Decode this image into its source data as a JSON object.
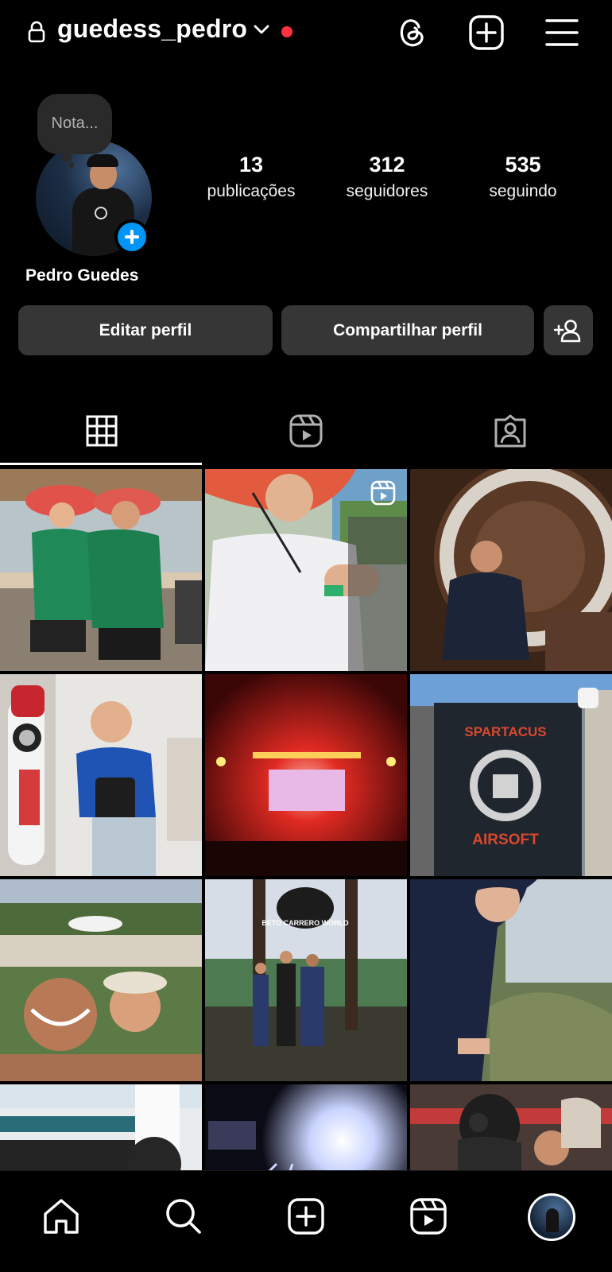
{
  "header": {
    "username": "guedess_pedro",
    "icons": [
      "lock-icon",
      "chevron-down-icon",
      "threads-icon",
      "create-post-icon",
      "menu-icon"
    ],
    "notification_color": "#ff3040"
  },
  "profile": {
    "note_placeholder": "Nota...",
    "full_name": "Pedro Guedes",
    "stats": {
      "posts_count": "13",
      "posts_label": "publicações",
      "followers_count": "312",
      "followers_label": "seguidores",
      "following_count": "535",
      "following_label": "seguindo"
    }
  },
  "actions": {
    "edit_label": "Editar perfil",
    "share_label": "Compartilhar perfil",
    "add_user_icon": "add-user-icon"
  },
  "tabs": [
    {
      "name": "posts-grid",
      "icon": "grid-icon",
      "active": true
    },
    {
      "name": "reels",
      "icon": "reels-icon",
      "active": false
    },
    {
      "name": "tagged",
      "icon": "tagged-icon",
      "active": false
    }
  ],
  "posts_grid": {
    "cells": [
      {
        "scene": "two people in green shirts and hats",
        "badge": ""
      },
      {
        "scene": "boy in white shirt with hat",
        "badge": "reel-icon"
      },
      {
        "scene": "boy seated in front of vault door",
        "badge": ""
      },
      {
        "scene": "child holding toy remote control",
        "badge": ""
      },
      {
        "scene": "concert stage with red lights",
        "badge": ""
      },
      {
        "scene": "Spartacus Airsoft banner",
        "badge": "carousel-icon"
      },
      {
        "scene": "family selfie at water park",
        "badge": ""
      },
      {
        "scene": "family at Beto Carrero World bridge",
        "badge": ""
      },
      {
        "scene": "boy in dark jacket outdoors",
        "badge": ""
      },
      {
        "scene": "arena building",
        "badge": ""
      },
      {
        "scene": "concert lights",
        "badge": ""
      },
      {
        "scene": "person in gas mask",
        "badge": ""
      }
    ],
    "text_in_photos": {
      "banner_top": "SPARTACUS",
      "banner_bottom": "AIRSOFT",
      "park_sign": "BETO CARRERO WORLD"
    }
  },
  "bottom_nav": [
    "home-icon",
    "search-icon",
    "create-icon",
    "reels-icon",
    "profile-avatar"
  ],
  "colors": {
    "background": "#000000",
    "button_bg": "#363636",
    "accent_blue": "#0095f6",
    "note_bg": "#2a2a2a"
  }
}
